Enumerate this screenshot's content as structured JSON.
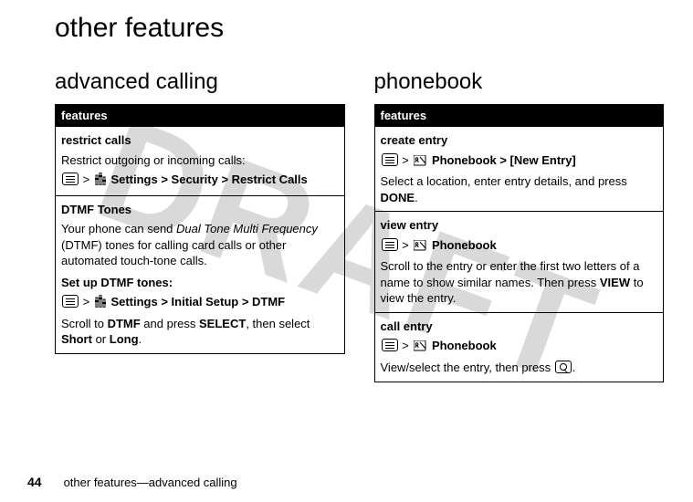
{
  "watermark": "DRAFT",
  "page_title": "other features",
  "page_number": "44",
  "footer_text": "other features—advanced calling",
  "left": {
    "heading": "advanced calling",
    "table_header": "features",
    "rows": [
      {
        "title": "restrict calls",
        "body1": "Restrict outgoing or incoming calls:",
        "path_prefix_icon": "menu-key",
        "path_sep1": " > ",
        "path_icon": "settings-icon",
        "path_text": " Settings > Security > Restrict Calls"
      },
      {
        "title": "DTMF Tones",
        "body1_pre": "Your phone can send ",
        "body1_em": "Dual Tone Multi Frequency",
        "body1_post": " (DTMF) tones for calling card calls or other automated touch-tone calls.",
        "subhead": "Set up DTMF tones:",
        "path_sep1": " > ",
        "path_text": " Settings > Initial Setup > DTMF",
        "body2_pre": "Scroll to ",
        "body2_b1": "DTMF",
        "body2_mid": " and press ",
        "body2_b2": "SELECT",
        "body2_mid2": ", then select ",
        "body2_b3": "Short",
        "body2_mid3": " or ",
        "body2_b4": "Long",
        "body2_end": "."
      }
    ]
  },
  "right": {
    "heading": "phonebook",
    "table_header": "features",
    "rows": [
      {
        "title": "create entry",
        "path_sep1": " > ",
        "path_text": " Phonebook > [New Entry]",
        "body1_pre": "Select a location, enter entry details, and press ",
        "body1_b1": "DONE",
        "body1_end": "."
      },
      {
        "title": "view entry",
        "path_sep1": " > ",
        "path_text": " Phonebook",
        "body1_pre": "Scroll to the entry or enter the first two letters of a name to show similar names. Then press ",
        "body1_b1": "VIEW",
        "body1_end": " to view the entry."
      },
      {
        "title": "call entry",
        "path_sep1": " > ",
        "path_text": " Phonebook",
        "body1_pre": "View/select the entry, then press ",
        "body1_end": "."
      }
    ]
  }
}
